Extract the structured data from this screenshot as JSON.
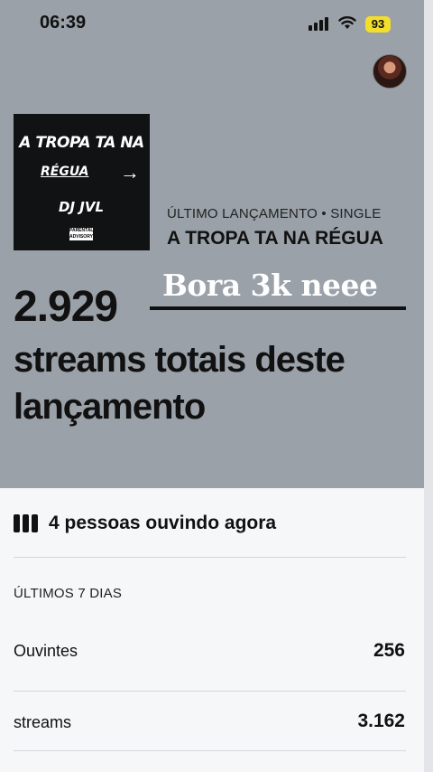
{
  "status_bar": {
    "time": "06:39",
    "battery": "93"
  },
  "release": {
    "cover_text": {
      "line1": "A TROPA TA NA",
      "line2": "RÉGUA",
      "line3": "DJ JVL"
    },
    "label": "ÚLTIMO LANÇAMENTO • SINGLE",
    "title": "A TROPA TA NA RÉGUA"
  },
  "stats": {
    "total_streams": "2.929",
    "description": "streams totais deste lançamento",
    "overlay_caption": "Bora 3k neee"
  },
  "live": {
    "text": "4 pessoas ouvindo agora"
  },
  "period": {
    "label": "ÚLTIMOS 7 DIAS",
    "rows": [
      {
        "label": "Ouvintes",
        "value": "256"
      },
      {
        "label": "streams",
        "value": "3.162"
      }
    ]
  }
}
